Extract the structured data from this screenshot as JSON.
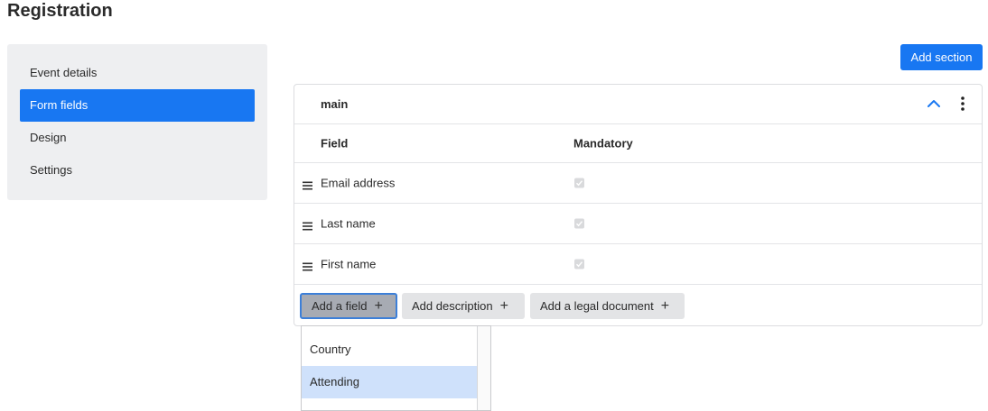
{
  "page": {
    "title": "Registration"
  },
  "sidebar": {
    "items": [
      {
        "label": "Event details"
      },
      {
        "label": "Form fields"
      },
      {
        "label": "Design"
      },
      {
        "label": "Settings"
      }
    ],
    "active_index": 1
  },
  "toolbar": {
    "add_section_label": "Add section"
  },
  "section": {
    "name": "main",
    "columns": {
      "field": "Field",
      "mandatory": "Mandatory"
    },
    "rows": [
      {
        "field": "Email address",
        "mandatory": true
      },
      {
        "field": "Last name",
        "mandatory": true
      },
      {
        "field": "First name",
        "mandatory": true
      }
    ],
    "actions": {
      "add_field": "Add a field",
      "add_description": "Add description",
      "add_legal_document": "Add a legal document"
    }
  },
  "dropdown": {
    "options": [
      {
        "label": "Country"
      },
      {
        "label": "Attending"
      }
    ],
    "highlighted_index": 1
  },
  "colors": {
    "accent": "#1877f2",
    "sidebar_bg": "#eeeff1",
    "highlight": "#cfe1fb"
  },
  "icons": {
    "collapse": "chevron-up-icon",
    "menu": "more-vertical-icon",
    "drag": "drag-handle-icon",
    "add": "plus-icon",
    "check": "check-icon"
  }
}
